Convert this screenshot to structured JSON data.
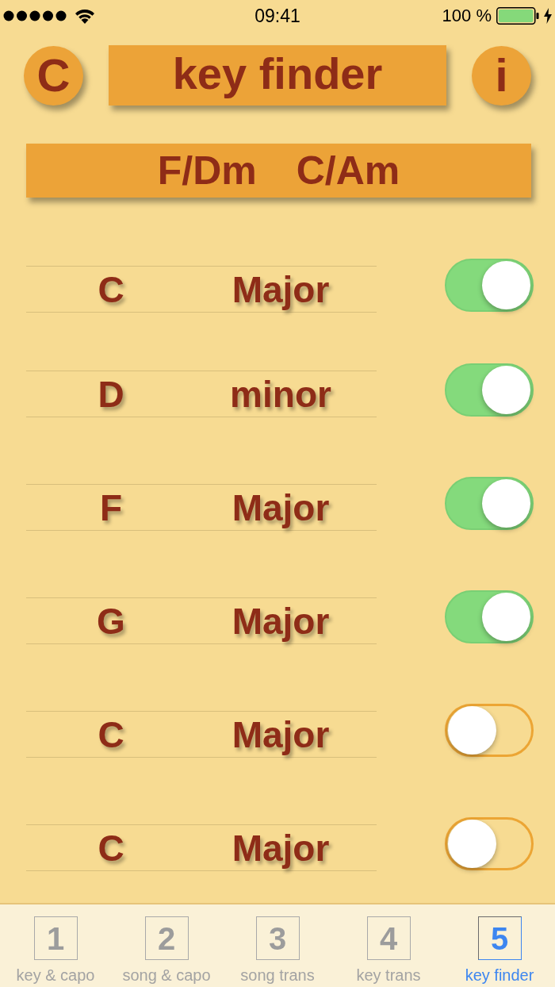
{
  "status_bar": {
    "time": "09:41",
    "battery": "100 %"
  },
  "header": {
    "left_button": "C",
    "title": "key finder",
    "right_button": "i"
  },
  "results": [
    "F/Dm",
    "C/Am"
  ],
  "rows": [
    {
      "key": "C",
      "mode": "Major",
      "on": true
    },
    {
      "key": "D",
      "mode": "minor",
      "on": true
    },
    {
      "key": "F",
      "mode": "Major",
      "on": true
    },
    {
      "key": "G",
      "mode": "Major",
      "on": true
    },
    {
      "key": "C",
      "mode": "Major",
      "on": false
    },
    {
      "key": "C",
      "mode": "Major",
      "on": false
    }
  ],
  "tabs": [
    {
      "number": "1",
      "label": "key & capo",
      "selected": false
    },
    {
      "number": "2",
      "label": "song & capo",
      "selected": false
    },
    {
      "number": "3",
      "label": "song trans",
      "selected": false
    },
    {
      "number": "4",
      "label": "key trans",
      "selected": false
    },
    {
      "number": "5",
      "label": "key finder",
      "selected": true
    }
  ]
}
